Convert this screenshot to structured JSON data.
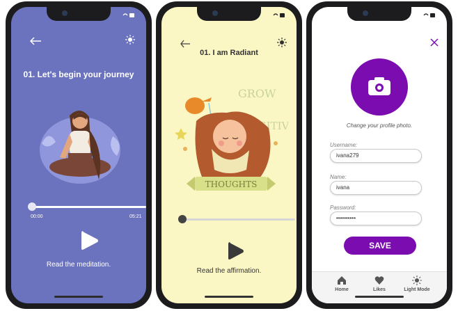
{
  "accent_colors": {
    "meditation_bg": "#6C73BE",
    "affirmation_bg": "#FBF7C4",
    "profile_accent": "#7B0DB0"
  },
  "meditation_screen": {
    "back_icon": "arrow-left-icon",
    "theme_icon": "sun-icon",
    "title": "01. Let's begin your journey",
    "progress_fraction": 0.0,
    "time_current": "00:00",
    "time_total": "05:21",
    "play_icon": "play-icon",
    "caption": "Read the meditation."
  },
  "affirmation_screen": {
    "back_icon": "arrow-left-icon",
    "theme_icon": "sun-icon",
    "title": "01. I am Radiant",
    "art_words": {
      "top": "GROW",
      "middle": "POSITIVE",
      "banner": "THOUGHTS"
    },
    "progress_fraction": 0.0,
    "play_icon": "play-icon",
    "caption": "Read the affirmation."
  },
  "profile_screen": {
    "close_icon": "close-icon",
    "camera_icon": "camera-icon",
    "change_photo_text": "Change your profile photo.",
    "username_label": "Username:",
    "username_value": "ivana279",
    "name_label": "Name:",
    "name_value": "ivana",
    "password_label": "Password:",
    "password_value": "••••••••••",
    "save_label": "SAVE",
    "tabs": [
      {
        "label": "Home",
        "icon": "home-icon"
      },
      {
        "label": "Likes",
        "icon": "heart-icon"
      },
      {
        "label": "Light Mode",
        "icon": "sun-icon"
      }
    ]
  }
}
